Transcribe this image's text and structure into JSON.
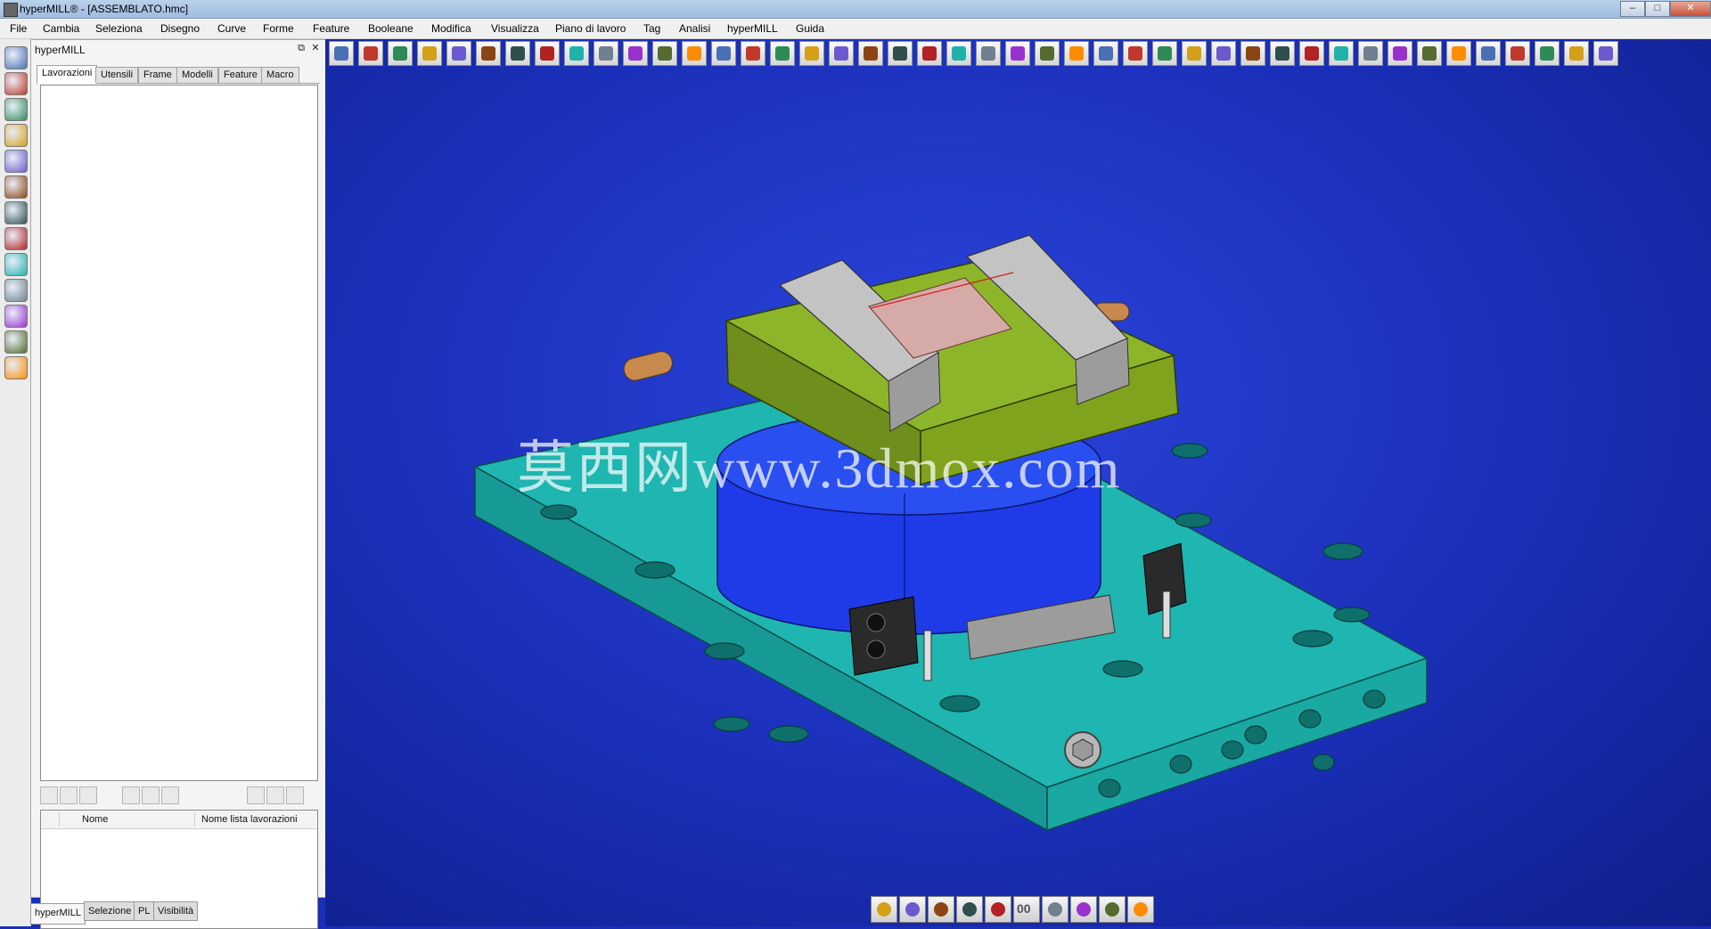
{
  "window": {
    "title": "hyperMILL® - [ASSEMBLATO.hmc]",
    "minimize_icon": "minimize-icon",
    "maximize_icon": "maximize-icon",
    "close_icon": "close-icon",
    "minimize_label": "–",
    "maximize_label": "□",
    "close_label": "✕"
  },
  "menu": [
    "File",
    "Cambia",
    "Seleziona",
    "Disegno",
    "Curve",
    "Forme",
    "Feature",
    "Booleane",
    "Modifica",
    "Visualizza",
    "Piano di lavoro",
    "Tag",
    "Analisi",
    "hyperMILL",
    "Guida"
  ],
  "left_toolbar_icons": [
    "layers-icon",
    "tool-icon",
    "settings-icon",
    "star-icon",
    "rotate-icon",
    "machine-icon",
    "boot-icon",
    "shapes-icon",
    "slash-icon",
    "grid-icon",
    "robot-icon",
    "help-icon",
    "document-icon"
  ],
  "panel": {
    "title": "hyperMILL",
    "float_label": "⧉",
    "close_label": "✕",
    "tabs": [
      "Lavorazioni",
      "Utensili",
      "Frame",
      "Modelli",
      "Feature",
      "Macro"
    ],
    "active_tab": "Lavorazioni",
    "mid_toolbar_icons": [
      "new-list-icon",
      "delete-icon",
      "comment-icon",
      "highlight-icon",
      "calculate-icon",
      "simulate-icon",
      "database-icon",
      "export-icon",
      "report-icon"
    ],
    "grid_columns": [
      "Nome",
      "Nome lista lavorazioni"
    ],
    "bottom_tabs": [
      "hyperMILL",
      "Selezione",
      "PL",
      "Visibilità"
    ],
    "active_bottom_tab": "hyperMILL"
  },
  "cad_toolbar_icons": [
    "new-file-icon",
    "open-icon",
    "box-icon",
    "refresh-icon",
    "monitor-icon",
    "page-icon",
    "page2-icon",
    "text-2d-icon",
    "undo-icon",
    "redo-icon",
    "solid-icon",
    "text-icon",
    "hammer-icon",
    "gear-icon",
    "sphere-icon",
    "arc-icon",
    "import-icon",
    "surface-icon",
    "axis-icon",
    "cube-icon",
    "wire-cube-icon",
    "shaded-cube-icon",
    "mesh-icon",
    "measure-icon",
    "circle-icon",
    "polygon-icon",
    "line-icon",
    "arc2-icon",
    "corner-icon",
    "curve-icon",
    "offset-icon",
    "trim-icon",
    "blend-icon",
    "star-icon",
    "funnel-icon",
    "extrude-icon",
    "revolve-icon",
    "sweep-icon",
    "loft-icon",
    "shell-icon",
    "cylinder-icon",
    "ball-icon",
    "shield-icon",
    "robot2-icon"
  ],
  "bottom_toolbar_icons": [
    "shade-icon",
    "gear-red-icon",
    "pencil-icon",
    "brush-icon",
    "pin-icon",
    "counter-icon",
    "trim-icon",
    "stamp-icon",
    "pen-icon",
    "globe-icon"
  ],
  "bottom_counter_label": "00",
  "watermark": "莫西网www.3dmox.com",
  "colors": {
    "viewport_bg": "#1a2fb8",
    "plate": "#1fb5b0",
    "vise_body": "#7fa31c",
    "rotary_base": "#1f3be8",
    "jaws": "#bcbcbc"
  }
}
